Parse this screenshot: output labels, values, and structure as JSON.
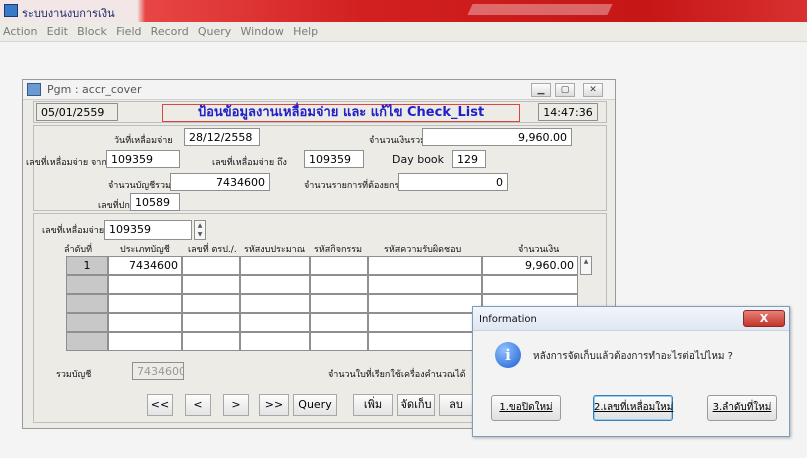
{
  "app": {
    "title": "ระบบงานงบการเงิน"
  },
  "menu": [
    "Action",
    "Edit",
    "Block",
    "Field",
    "Record",
    "Query",
    "Window",
    "Help"
  ],
  "form": {
    "window_title": "Pgm  :  accr_cover",
    "header": {
      "date": "05/01/2559",
      "title": "ป้อนข้อมูลงานเหลื่อมจ่าย และ แก้ไข Check_List",
      "time": "14:47:36"
    },
    "top": {
      "pay_date_label": "วันที่เหลื่อมจ่าย",
      "pay_date": "28/12/2558",
      "total_amount_label": "จำนวนเงินรวม",
      "total_amount": "9,960.00",
      "from_no_label": "เลขที่เหลื่อมจ่าย จาก",
      "from_no": "109359",
      "to_no_label": "เลขที่เหลื่อมจ่าย ถึง",
      "to_no": "109359",
      "daybook_label": "Day book",
      "daybook": "129",
      "account_total_label": "จำนวนบัญชีรวม",
      "account_total": "7434600",
      "total_items_label": "จำนวนรายการที่ต้องยกรวม",
      "total_items": "0",
      "cover_no_label": "เลขที่ปก",
      "cover_no": "10589"
    },
    "detail": {
      "pay_no_label": "เลขที่เหลื่อมจ่าย",
      "pay_no": "109359",
      "columns": [
        "ลำดับที่",
        "ประเภทบัญชี",
        "เลขที่ ตรป./.",
        "รหัสงบประมาณ",
        "รหัสกิจกรรม",
        "รหัสความรับผิดชอบ",
        "จำนวนเงิน"
      ],
      "rows": [
        {
          "seq": "1",
          "account": "7434600",
          "amount": "9,960.00"
        },
        {
          "seq": "",
          "account": "",
          "amount": ""
        },
        {
          "seq": "",
          "account": "",
          "amount": ""
        },
        {
          "seq": "",
          "account": "",
          "amount": ""
        },
        {
          "seq": "",
          "account": "",
          "amount": ""
        }
      ],
      "total_account_label": "รวมบัญชี",
      "total_account": "7434600",
      "reference_label": "จำนวนใบที่เรียกใช้เครื่องคำนวณได้"
    },
    "buttons": {
      "first": "<<",
      "prev": "<",
      "next": ">",
      "last": ">>",
      "query": "Query",
      "add": "เพิ่ม",
      "save": "จัดเก็บ",
      "delete": "ลบ"
    }
  },
  "dialog": {
    "title": "Information",
    "message": "หลังการจัดเก็บแล้วต้องการทำอะไรต่อไปไหม ?",
    "buttons": [
      "1.ขอปิดใหม่",
      "2.เลขที่เหลื่อมใหม่",
      "3.ลำดับที่ใหม่"
    ]
  },
  "colors": {
    "title_blue": "#2020c8",
    "titlebar_red": "#c61616",
    "border_red": "#dd4444"
  }
}
